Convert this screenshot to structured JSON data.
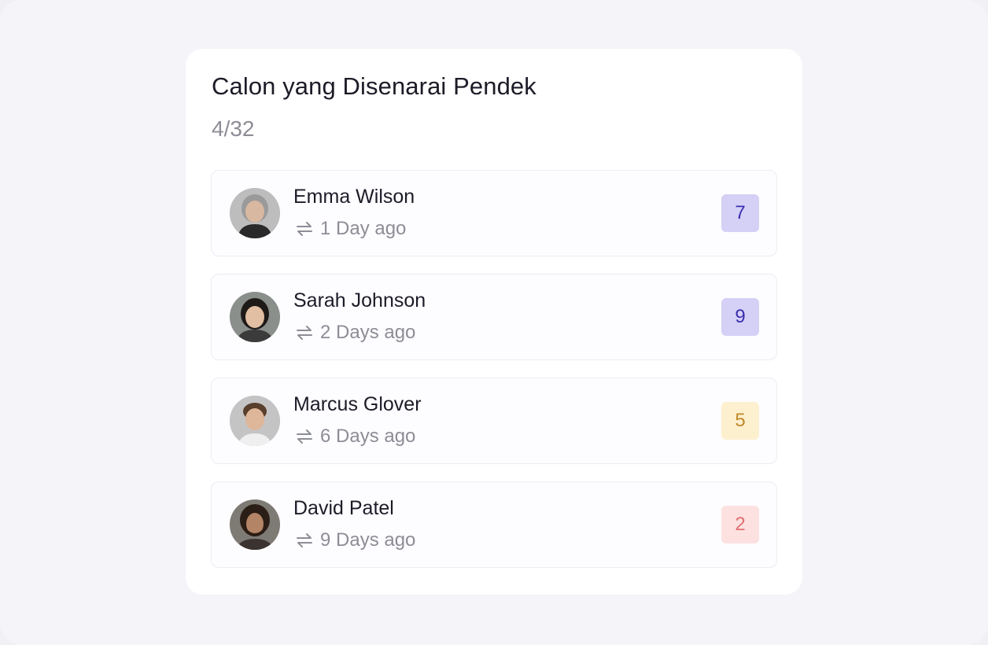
{
  "card": {
    "title": "Calon yang Disenarai Pendek",
    "count": "4/32"
  },
  "candidates": [
    {
      "name": "Emma Wilson",
      "time": "1 Day ago",
      "score": "7",
      "score_bg": "#d5d0f6",
      "score_color": "#3b2fae",
      "avatar_icon": "avatar-photo"
    },
    {
      "name": "Sarah Johnson",
      "time": "2 Days ago",
      "score": "9",
      "score_bg": "#d5d0f6",
      "score_color": "#3b2fae",
      "avatar_icon": "avatar-photo"
    },
    {
      "name": "Marcus Glover",
      "time": "6 Days ago",
      "score": "5",
      "score_bg": "#fdf0cf",
      "score_color": "#c08a2a",
      "avatar_icon": "avatar-photo"
    },
    {
      "name": "David Patel",
      "time": "9 Days ago",
      "score": "2",
      "score_bg": "#fde1e1",
      "score_color": "#e07070",
      "avatar_icon": "avatar-photo"
    }
  ],
  "icons": {
    "meta_icon": "swap-arrows-icon"
  }
}
